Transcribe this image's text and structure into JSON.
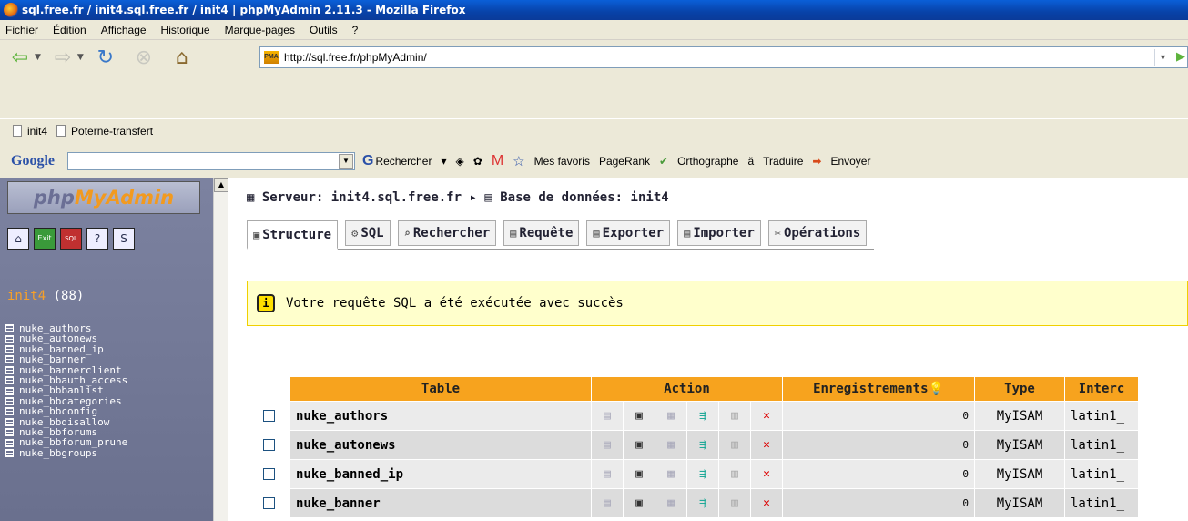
{
  "window": {
    "title": "sql.free.fr / init4.sql.free.fr / init4 | phpMyAdmin 2.11.3 - Mozilla Firefox"
  },
  "menu": [
    "Fichier",
    "Édition",
    "Affichage",
    "Historique",
    "Marque-pages",
    "Outils",
    "?"
  ],
  "address_bar": {
    "url": "http://sql.free.fr/phpMyAdmin/"
  },
  "bookmarks": [
    "init4",
    "Poterne-transfert"
  ],
  "google_toolbar": {
    "logo": "Google",
    "search_label": "Rechercher",
    "favorites_label": "Mes favoris",
    "pagerank_label": "PageRank",
    "spell_label": "Orthographe",
    "translate_label": "Traduire",
    "send_label": "Envoyer"
  },
  "sidebar": {
    "logo_php": "php",
    "logo_myadmin": "MyAdmin",
    "db_name": "init4",
    "db_count": "(88)",
    "tables": [
      "nuke_authors",
      "nuke_autonews",
      "nuke_banned_ip",
      "nuke_banner",
      "nuke_bannerclient",
      "nuke_bbauth_access",
      "nuke_bbbanlist",
      "nuke_bbcategories",
      "nuke_bbconfig",
      "nuke_bbdisallow",
      "nuke_bbforums",
      "nuke_bbforum_prune",
      "nuke_bbgroups"
    ]
  },
  "main": {
    "breadcrumb_server_label": "Serveur:",
    "breadcrumb_server": "init4.sql.free.fr",
    "breadcrumb_db_label": "Base de données:",
    "breadcrumb_db": "init4",
    "tabs": [
      "Structure",
      "SQL",
      "Rechercher",
      "Requête",
      "Exporter",
      "Importer",
      "Opérations"
    ],
    "notice": "Votre requête SQL a été exécutée avec succès",
    "table_headers": {
      "table": "Table",
      "action": "Action",
      "records": "Enregistrements",
      "type": "Type",
      "collation": "Interc"
    },
    "rows": [
      {
        "name": "nuke_authors",
        "records": "0",
        "type": "MyISAM",
        "collation": "latin1_"
      },
      {
        "name": "nuke_autonews",
        "records": "0",
        "type": "MyISAM",
        "collation": "latin1_"
      },
      {
        "name": "nuke_banned_ip",
        "records": "0",
        "type": "MyISAM",
        "collation": "latin1_"
      },
      {
        "name": "nuke_banner",
        "records": "0",
        "type": "MyISAM",
        "collation": "latin1_"
      }
    ]
  }
}
